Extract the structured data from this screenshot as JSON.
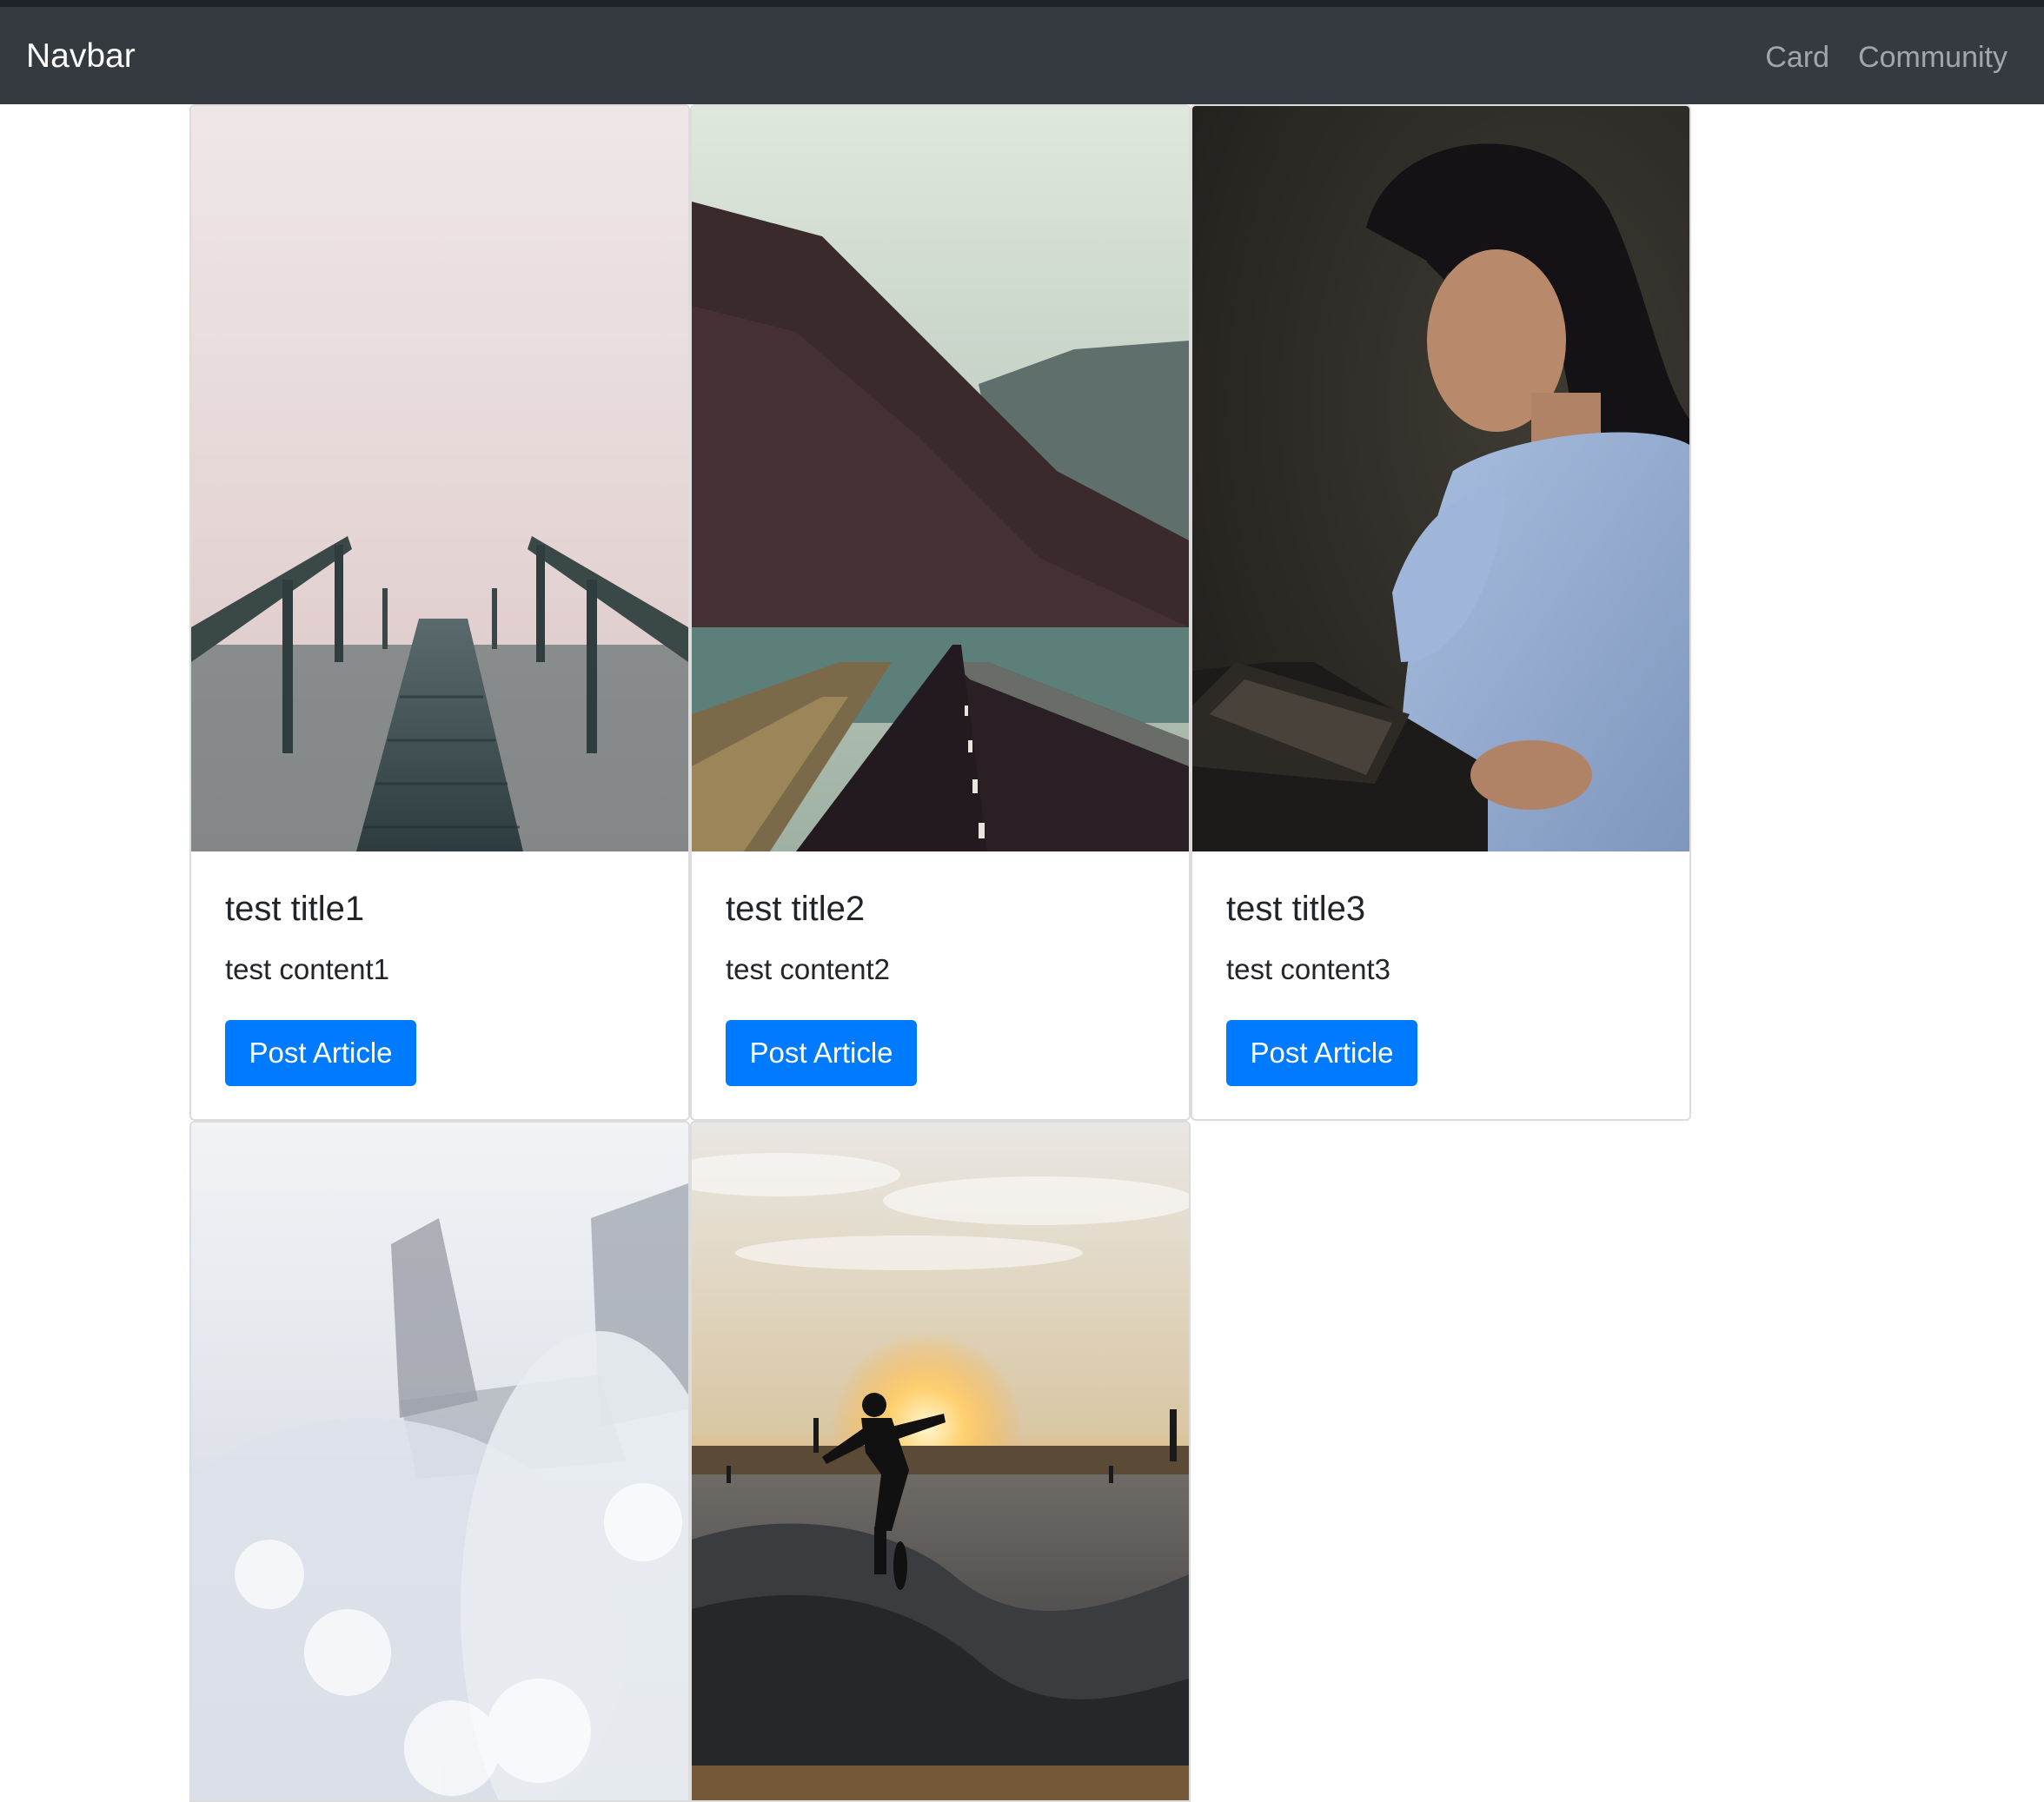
{
  "navbar": {
    "brand": "Navbar",
    "links": [
      "Card",
      "Community"
    ]
  },
  "cards": [
    {
      "title": "test title1",
      "content": "test content1",
      "button": "Post Article"
    },
    {
      "title": "test title2",
      "content": "test content2",
      "button": "Post Article"
    },
    {
      "title": "test title3",
      "content": "test content3",
      "button": "Post Article"
    }
  ],
  "colors": {
    "navbar_bg": "#343a40",
    "primary": "#007bff"
  }
}
